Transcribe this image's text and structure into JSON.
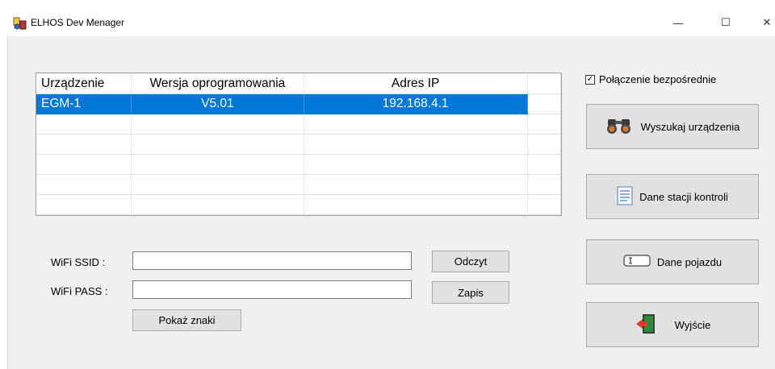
{
  "window": {
    "title": "ELHOS Dev Menager",
    "minimize_glyph": "—",
    "maximize_glyph": "☐",
    "close_glyph": "✕"
  },
  "grid": {
    "columns": [
      "Urządzenie",
      "Wersja oprogramowania",
      "Adres IP"
    ],
    "rows": [
      {
        "device": "EGM-1",
        "version": "V5.01",
        "ip": "192.168.4.1",
        "selected": true
      }
    ],
    "selection_color": "#0078d7"
  },
  "options": {
    "direct_connection_label": "Połączenie bezpośrednie",
    "direct_connection_checked": true
  },
  "buttons": {
    "search_devices": "Wyszukaj urządzenia",
    "station_data": "Dane stacji kontroli",
    "vehicle_data": "Dane pojazdu",
    "exit": "Wyjście",
    "read": "Odczyt",
    "write": "Zapis",
    "show_chars": "Pokaż znaki"
  },
  "wifi": {
    "ssid_label": "WiFi SSID :",
    "ssid_value": "",
    "pass_label": "WiFi PASS :",
    "pass_value": ""
  },
  "icons": {
    "app": "elhos-app-icon",
    "search": "binoculars-icon",
    "station": "document-icon",
    "vehicle": "text-cursor-icon",
    "exit": "exit-door-icon"
  }
}
